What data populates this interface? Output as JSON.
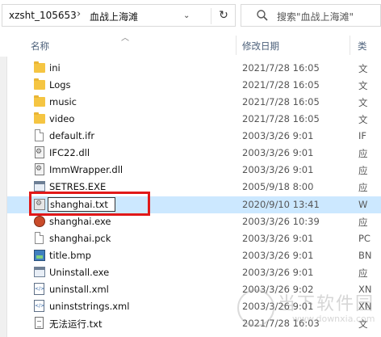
{
  "address": {
    "parent": "xzsht_105653",
    "current": "血战上海滩",
    "separator": "›",
    "refresh_glyph": "↻",
    "dropdown_glyph": "⌄"
  },
  "search": {
    "placeholder": "搜索\"血战上海滩\""
  },
  "columns": {
    "name": "名称",
    "date": "修改日期",
    "type": "类"
  },
  "files": [
    {
      "name": "ini",
      "date": "2021/7/28 16:05",
      "type": "文",
      "icon": "folder-icon"
    },
    {
      "name": "Logs",
      "date": "2021/7/28 16:05",
      "type": "文",
      "icon": "folder-icon"
    },
    {
      "name": "music",
      "date": "2021/7/28 16:05",
      "type": "文",
      "icon": "folder-icon"
    },
    {
      "name": "video",
      "date": "2021/7/28 16:05",
      "type": "文",
      "icon": "folder-icon"
    },
    {
      "name": "default.ifr",
      "date": "2003/3/26 9:01",
      "type": "IF",
      "icon": "file-icon"
    },
    {
      "name": "IFC22.dll",
      "date": "2003/3/26 9:01",
      "type": "应",
      "icon": "dll-icon"
    },
    {
      "name": "ImmWrapper.dll",
      "date": "2003/3/26 9:01",
      "type": "应",
      "icon": "dll-icon"
    },
    {
      "name": "SETRES.EXE",
      "date": "2005/9/18 8:00",
      "type": "应",
      "icon": "exe-icon"
    },
    {
      "name": "shanghai.txt",
      "date": "2020/9/10 13:41",
      "type": "W",
      "icon": "settings-file-icon"
    },
    {
      "name": "shanghai.exe",
      "date": "2003/3/26 10:39",
      "type": "应",
      "icon": "shanghai-exe-icon"
    },
    {
      "name": "shanghai.pck",
      "date": "2003/3/26 9:01",
      "type": "PC",
      "icon": "file-icon"
    },
    {
      "name": "title.bmp",
      "date": "2003/3/26 9:01",
      "type": "BN",
      "icon": "bmp-icon"
    },
    {
      "name": "Uninstall.exe",
      "date": "2003/3/26 9:01",
      "type": "应",
      "icon": "uninstall-icon"
    },
    {
      "name": "uninstall.xml",
      "date": "2003/3/26 9:02",
      "type": "XN",
      "icon": "xml-icon"
    },
    {
      "name": "uninststrings.xml",
      "date": "2003/3/26 9:01",
      "type": "XN",
      "icon": "xml-icon"
    },
    {
      "name": "无法运行.txt",
      "date": "2021/7/28 16:03",
      "type": "文",
      "icon": "text-file-icon"
    }
  ],
  "watermark": {
    "line1": "当下软件园",
    "line2": "www.downxia.com"
  }
}
